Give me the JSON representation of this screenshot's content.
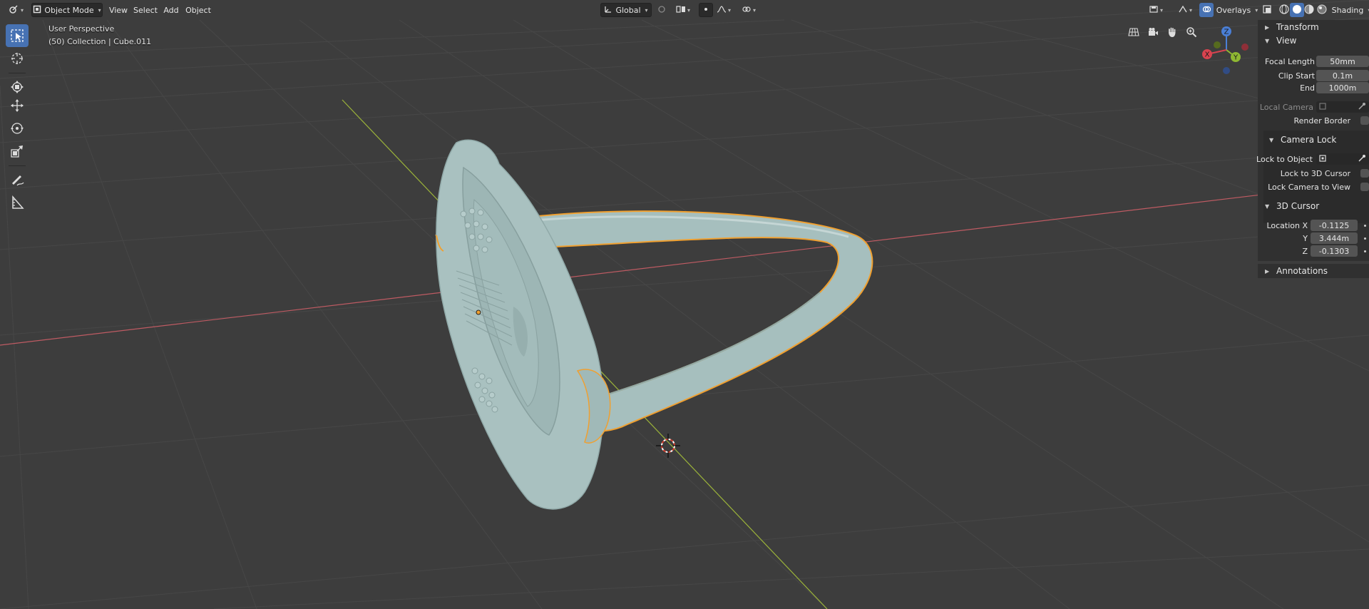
{
  "header": {
    "mode": "Object Mode",
    "menus": [
      "View",
      "Select",
      "Add",
      "Object"
    ],
    "transform_orientation": "Global",
    "overlays_label": "Overlays",
    "shading_label": "Shading"
  },
  "viewport": {
    "perspective": "User Perspective",
    "collection": "(50) Collection | Cube.011"
  },
  "gizmo": {
    "x": "X",
    "y": "Y",
    "z": "Z"
  },
  "sidebar": {
    "transform": {
      "title": "Transform",
      "expanded": false
    },
    "view": {
      "title": "View",
      "focal_length_label": "Focal Length",
      "focal_length": "50mm",
      "clip_start_label": "Clip Start",
      "clip_start": "0.1m",
      "end_label": "End",
      "end": "1000m",
      "local_camera_label": "Local Camera",
      "render_border_label": "Render Border"
    },
    "camera_lock": {
      "title": "Camera Lock",
      "lock_to_object_label": "Lock to Object",
      "lock_to_3d_cursor_label": "Lock to 3D Cursor",
      "lock_camera_to_view_label": "Lock Camera to View"
    },
    "cursor": {
      "title": "3D Cursor",
      "location_x_label": "Location X",
      "location_x": "-0.1125",
      "y_label": "Y",
      "y": "3.444m",
      "z_label": "Z",
      "z": "-0.1303"
    },
    "annotations": {
      "title": "Annotations",
      "expanded": false
    }
  },
  "colors": {
    "viewport_bg": "#3d3d3d",
    "grid": "#4a4a4a",
    "x_axis": "#bf5b63",
    "y_axis": "#9bb33a",
    "selection_outline": "#f0a030",
    "model_fill": "#a9c1c0",
    "accent": "#4772b3"
  },
  "icons": [
    "editor-type-icon",
    "object-mode-icon",
    "transform-pivot-icon",
    "snap-icon",
    "proportional-edit-icon",
    "visibility-icon",
    "overlays-icon",
    "shading-solid-icon",
    "select-box-icon",
    "cursor-icon",
    "move-icon",
    "rotate-icon",
    "scale-icon",
    "annotate-icon",
    "measure-icon",
    "grid-icon",
    "camera-icon",
    "hand-pan-icon",
    "zoom-icon"
  ]
}
